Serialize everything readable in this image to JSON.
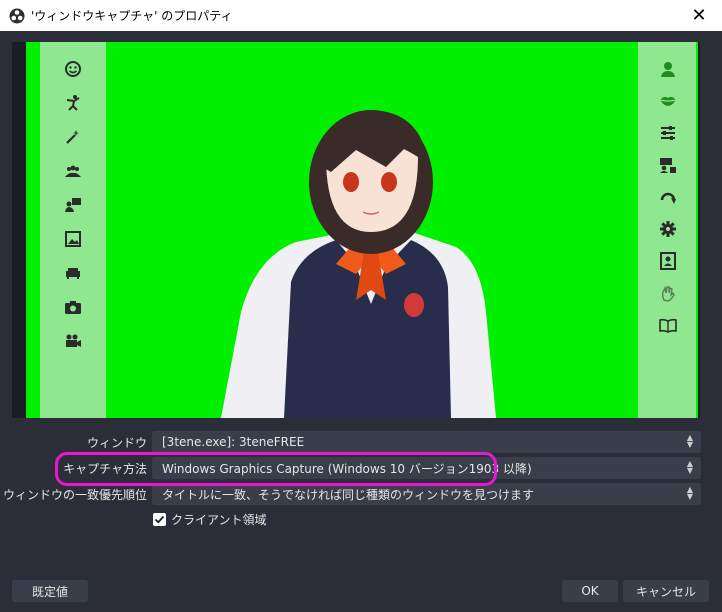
{
  "window": {
    "title": "'ウィンドウキャプチャ' のプロパティ",
    "close_glyph": "✕"
  },
  "form": {
    "window": {
      "label": "ウィンドウ",
      "value": "[3tene.exe]: 3teneFREE"
    },
    "capture_method": {
      "label": "キャプチャ方法",
      "value": "Windows Graphics Capture (Windows 10 バージョン1903 以降)"
    },
    "window_priority": {
      "label": "ウィンドウの一致優先順位",
      "value": "タイトルに一致、そうでなければ同じ種類のウィンドウを見つけます"
    },
    "client_area": {
      "label": "クライアント領域",
      "checked": true
    }
  },
  "buttons": {
    "defaults": "既定値",
    "ok": "OK",
    "cancel": "キャンセル"
  },
  "preview": {
    "background_color": "#00f000",
    "panel_color": "#8fe88f",
    "left_icons": [
      "face-icon",
      "pose-icon",
      "magic-wand-icon",
      "group-icon",
      "presenter-icon",
      "image-icon",
      "sofa-icon",
      "camera-icon",
      "video-camera-icon"
    ],
    "right_icons": [
      "avatar-icon",
      "lips-icon",
      "sliders-icon",
      "motion-capture-icon",
      "rotate-icon",
      "settings-icon",
      "contact-card-icon",
      "hand-wave-icon",
      "book-icon"
    ]
  },
  "colors": {
    "highlight": "#e519d0",
    "dialog_bg": "#2b2e38",
    "field_bg": "#3a3e4a"
  }
}
